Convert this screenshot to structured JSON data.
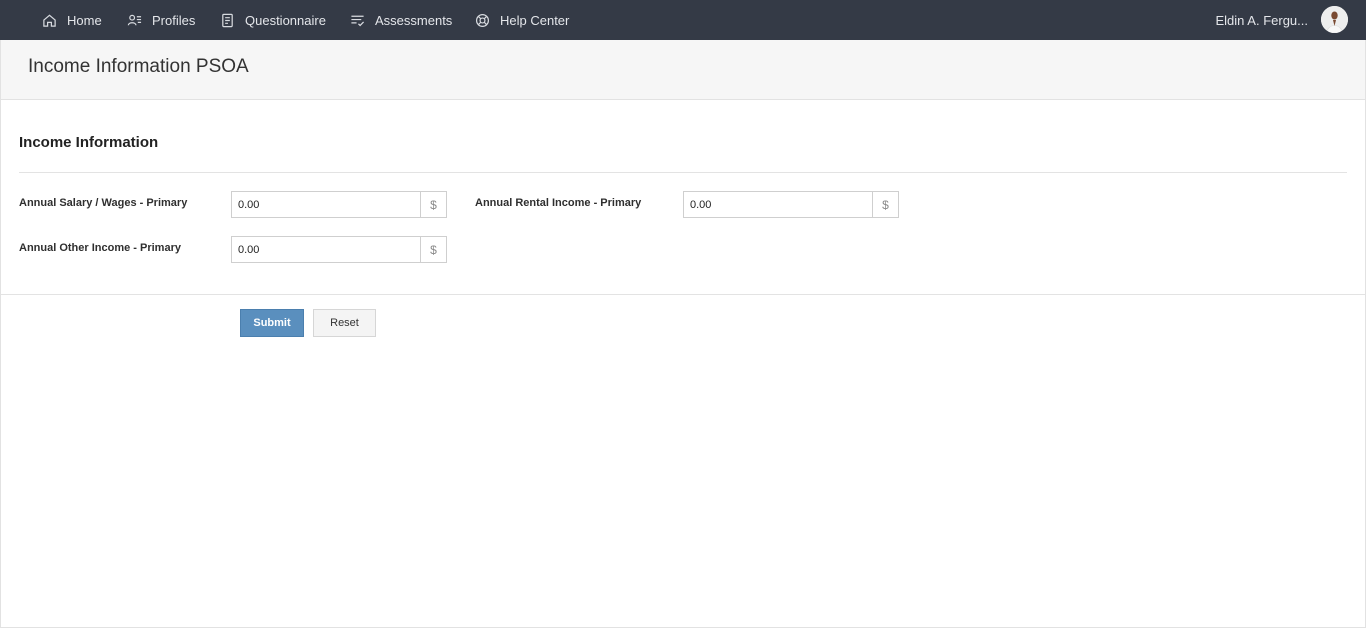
{
  "nav": {
    "items": [
      {
        "label": "Home",
        "icon": "home-icon"
      },
      {
        "label": "Profiles",
        "icon": "profiles-icon"
      },
      {
        "label": "Questionnaire",
        "icon": "questionnaire-icon"
      },
      {
        "label": "Assessments",
        "icon": "assessments-icon"
      },
      {
        "label": "Help Center",
        "icon": "help-center-icon"
      }
    ],
    "user_name": "Eldin A. Fergu..."
  },
  "header": {
    "title": "Income Information PSOA"
  },
  "form": {
    "section_title": "Income Information",
    "fields": [
      {
        "label": "Annual Salary / Wages - Primary",
        "value": "0.00",
        "addon": "$"
      },
      {
        "label": "Annual Rental Income - Primary",
        "value": "0.00",
        "addon": "$"
      },
      {
        "label": "Annual Other Income - Primary",
        "value": "0.00",
        "addon": "$"
      }
    ],
    "submit_label": "Submit",
    "reset_label": "Reset"
  },
  "colors": {
    "topbar": "#343a46",
    "primary_button": "#5a8fbe"
  }
}
